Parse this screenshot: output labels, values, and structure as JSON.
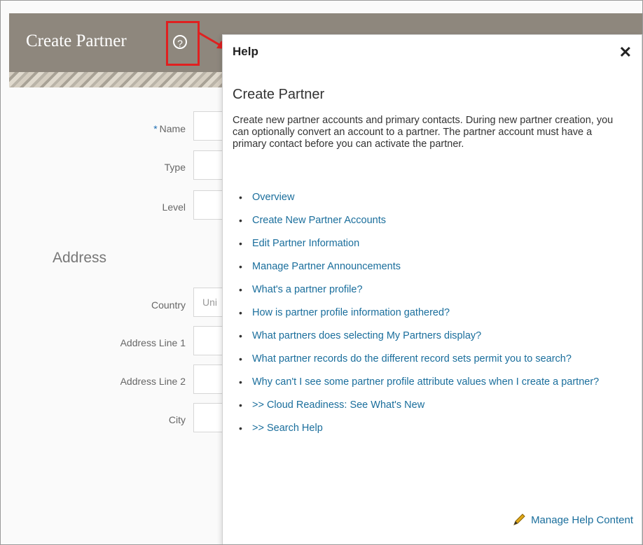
{
  "page": {
    "title": "Create Partner"
  },
  "form": {
    "fields": [
      {
        "label": "Name",
        "required": true,
        "value": ""
      },
      {
        "label": "Type",
        "required": false,
        "value": ""
      },
      {
        "label": "Level",
        "required": false,
        "value": ""
      }
    ],
    "address_section_title": "Address",
    "address_fields": [
      {
        "label": "Country",
        "value": "Uni"
      },
      {
        "label": "Address Line 1",
        "value": ""
      },
      {
        "label": "Address Line 2",
        "value": ""
      },
      {
        "label": "City",
        "value": ""
      }
    ],
    "required_marker": "*"
  },
  "help": {
    "heading": "Help",
    "close_glyph": "✕",
    "topic_title": "Create Partner",
    "description": "Create new partner accounts and primary contacts. During new partner creation, you can optionally convert an account to a partner. The partner account must have a primary contact before you can activate the partner.",
    "links": [
      "Overview",
      "Create New Partner Accounts",
      "Edit Partner Information",
      "Manage Partner Announcements",
      "What's a partner profile?",
      "How is partner profile information gathered?",
      "What partners does selecting My Partners display?",
      "What partner records do the different record sets permit you to search?",
      "Why can't I see some partner profile attribute values when I create a partner?",
      ">> Cloud Readiness: See What's New",
      ">> Search Help"
    ],
    "manage_label": "Manage Help Content"
  },
  "colors": {
    "header_bg": "#8e877d",
    "link": "#1a6e9c",
    "highlight": "#e02020"
  }
}
